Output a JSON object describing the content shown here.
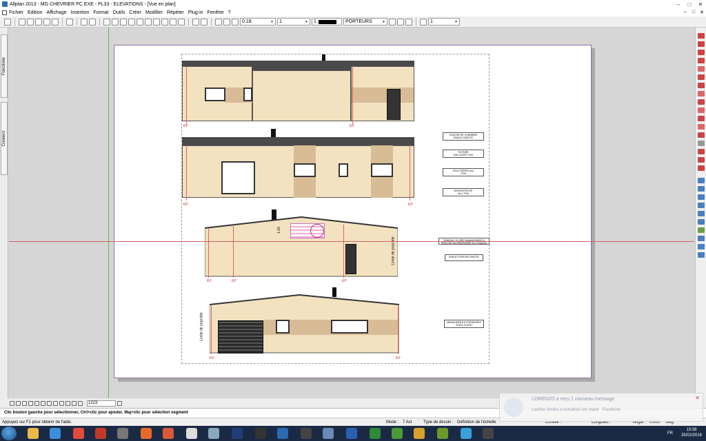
{
  "window": {
    "title": "Allplan 2013 - MG CHEVRIER PC EXE - PL33 - ELEVATIONS - [Vue en plan]",
    "controls": [
      "–",
      "□",
      "✕"
    ]
  },
  "menu": {
    "items": [
      "Fichier",
      "Edition",
      "Affichage",
      "Insertion",
      "Format",
      "Outils",
      "Créer",
      "Modifier",
      "Répéter",
      "Plug-in",
      "Fenêtre",
      "?"
    ],
    "right_controls": [
      "–",
      "□",
      "✕"
    ]
  },
  "toolbar": {
    "pen_thickness": "0.18",
    "line_type": "1",
    "color_index": "1",
    "layer": "PORTEURS",
    "pattern_index": "1"
  },
  "side_tabs": {
    "fonctions": "Fonctions",
    "connect": "Connect"
  },
  "drawing": {
    "ep_label": "EP",
    "dimension": "1.00",
    "limite_label": "Limite de propriété",
    "legend": [
      "SOUCHE DE CHEMINEE\nENDUIT GRATTE",
      "TOITURE\nBAC ACIER 7016",
      "GOUTTIERES ALU\n7016",
      "DESCENTES EP\nALU 7016",
      "PANEAUX CLOIRS MANAGEMENT A\nPREVOIR EN PERIPHERIE DU CHASSIS",
      "ENDUIT FINITION GRATTE",
      "MENUISERIES EXTERIEURES\nCHOIX CLIENT"
    ]
  },
  "zoom_value": "1223",
  "prompt_text": "Clic bouton gauche pour sélectionner, Ctrl+clic pour ajouter, Maj+clic pour sélection segment",
  "status": {
    "help": "Appuyez sur F1 pour obtenir de l'aide.",
    "mode_label": "Mode :",
    "mode_value": "7 Act",
    "type_label": "Type de dessin :",
    "type_value": "Définition de l'échelle",
    "echelle_label": "Échelle :",
    "longueur_label": "Longueur :",
    "angle_label": "Angle :",
    "angle_value": "0.000",
    "deg": "Deg"
  },
  "notification": {
    "title": "LORENZO a reçu 1 nouveau message",
    "body": "Laetitia Verdes a actualisé son statut",
    "source": "Facebook",
    "close": "✕"
  },
  "taskbar": {
    "time": "13:38",
    "date": "25/02/2016",
    "lang": "FR"
  },
  "colors": {
    "crosshair": "#d06060",
    "green_axis": "#52c152",
    "taskbar": "#1b2a44",
    "wall": "#f3e2c0",
    "band": "#d8bc96"
  }
}
